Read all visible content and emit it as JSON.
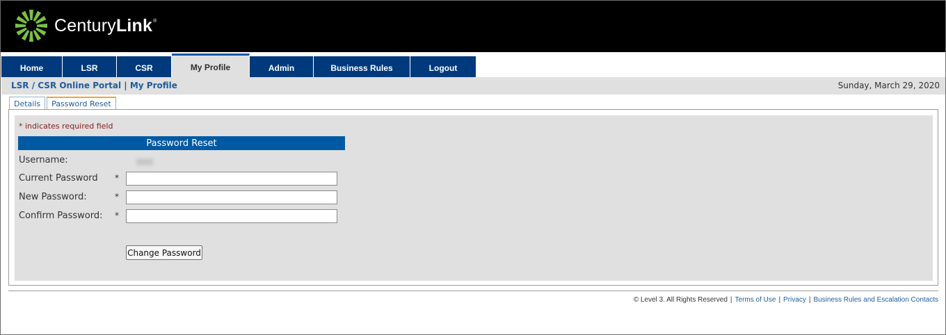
{
  "brand": {
    "name_regular": "Century",
    "name_bold": "Link",
    "trademark": "®"
  },
  "nav": {
    "items": [
      {
        "label": "Home",
        "active": false
      },
      {
        "label": "LSR",
        "active": false
      },
      {
        "label": "CSR",
        "active": false
      },
      {
        "label": "My Profile",
        "active": true
      },
      {
        "label": "Admin",
        "active": false
      },
      {
        "label": "Business Rules",
        "active": false
      },
      {
        "label": "Logout",
        "active": false
      }
    ]
  },
  "breadcrumb": {
    "portal": "LSR / CSR Online Portal",
    "separator": "|",
    "current": "My Profile"
  },
  "date": "Sunday, March 29, 2020",
  "subtabs": [
    {
      "label": "Details",
      "active": false
    },
    {
      "label": "Password Reset",
      "active": true
    }
  ],
  "form": {
    "required_note": "* indicates required field",
    "section_title": "Password Reset",
    "username_label": "Username:",
    "current_password_label": "Current Password",
    "new_password_label": "New Password:",
    "confirm_password_label": "Confirm Password:",
    "required_marker": "*",
    "current_password_value": "",
    "new_password_value": "",
    "confirm_password_value": "",
    "submit_label": "Change Password"
  },
  "footer": {
    "copyright": "© Level 3. All Rights Reserved",
    "separator": "|",
    "terms": "Terms of Use",
    "privacy": "Privacy",
    "contacts": "Business Rules and Escalation Contacts"
  },
  "colors": {
    "nav_blue": "#003a7d",
    "section_blue": "#005aa3",
    "link_blue": "#1f5c9e",
    "panel_gray": "#dfe0df",
    "logo_green": "#7bc142"
  }
}
